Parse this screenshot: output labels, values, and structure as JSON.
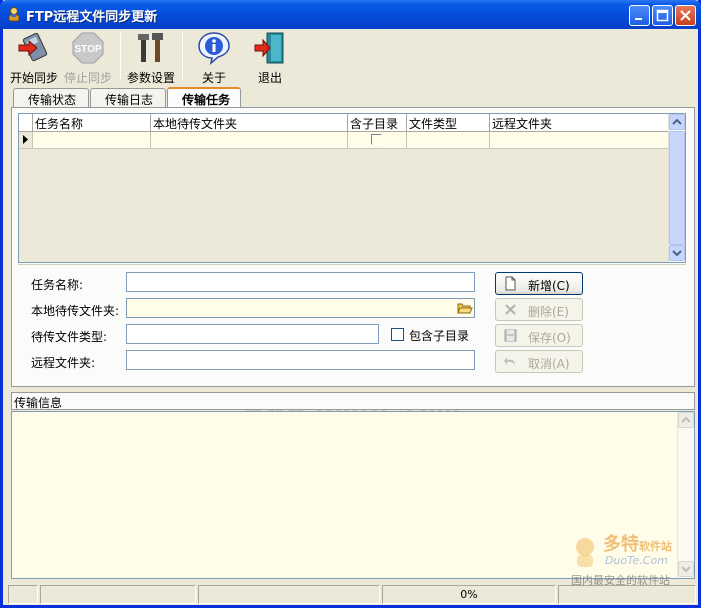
{
  "window": {
    "title": "FTP远程文件同步更新"
  },
  "toolbar": {
    "start_sync": "开始同步",
    "stop_sync": "停止同步",
    "settings": "参数设置",
    "about": "关于",
    "exit": "退出",
    "stop_icon_text": "STOP"
  },
  "tabs": [
    {
      "label": "传输状态"
    },
    {
      "label": "传输日志"
    },
    {
      "label": "传输任务",
      "active": true
    }
  ],
  "grid": {
    "columns": [
      "任务名称",
      "本地待传文件夹",
      "含子目录",
      "文件类型",
      "远程文件夹"
    ],
    "rows": [
      {
        "task_name": "",
        "local_folder": "",
        "include_subdirs": false,
        "file_type": "",
        "remote_folder": ""
      }
    ]
  },
  "form": {
    "task_name_label": "任务名称:",
    "task_name_value": "",
    "local_folder_label": "本地待传文件夹:",
    "local_folder_value": "",
    "file_type_label": "待传文件类型:",
    "file_type_value": "",
    "include_subdirs_label": "包含子目录",
    "include_subdirs_checked": false,
    "remote_folder_label": "远程文件夹:",
    "remote_folder_value": ""
  },
  "actions": {
    "add": "新增(C)",
    "delete": "删除(E)",
    "save": "保存(O)",
    "cancel": "取消(A)"
  },
  "info": {
    "header": "传输信息",
    "content": ""
  },
  "status": {
    "progress": "0%"
  },
  "watermark": {
    "site": "www.DuoTe.com",
    "logo_main": "多特",
    "logo_sub": "软件站",
    "logo_url": "DuoTe.Com",
    "slogan": "国内最安全的软件站"
  },
  "colors": {
    "titlebar": "#0649d8",
    "window_bg": "#ece9d8",
    "grid_row_bg": "#fffdea",
    "active_tab_accent": "#e68b2c"
  }
}
